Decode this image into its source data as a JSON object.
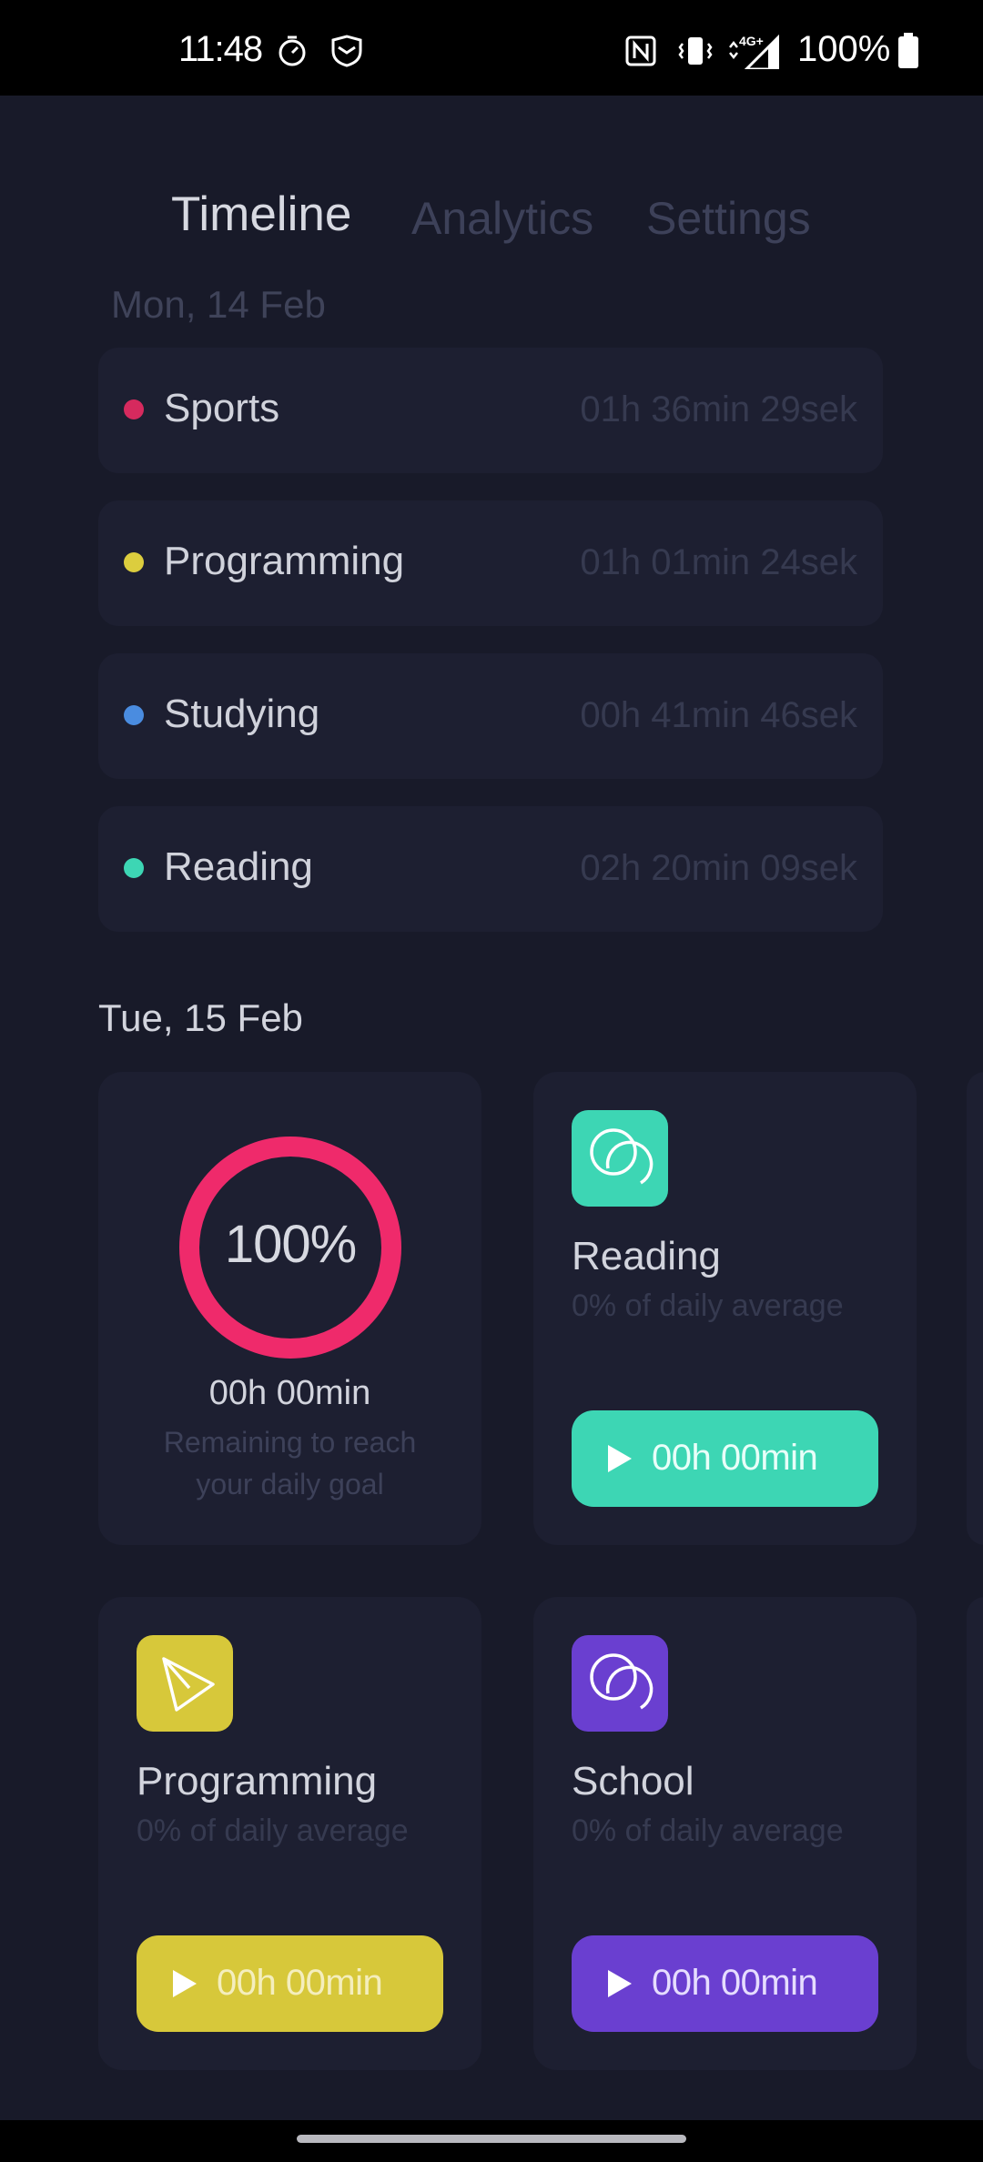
{
  "status_bar": {
    "time": "11:48",
    "battery": "100%",
    "icons": [
      "stopwatch-icon",
      "app-shield-icon",
      "nfc-icon",
      "vibrate-icon",
      "signal-4g-icon",
      "battery-icon"
    ]
  },
  "tabs": [
    {
      "label": "Timeline",
      "active": true
    },
    {
      "label": "Analytics",
      "active": false
    },
    {
      "label": "Settings",
      "active": false
    }
  ],
  "timeline": {
    "day1": {
      "label": "Mon, 14 Feb",
      "entries": [
        {
          "name": "Sports",
          "duration": "01h 36min 29sek",
          "color": "#d62a5e"
        },
        {
          "name": "Programming",
          "duration": "01h 01min 24sek",
          "color": "#dccd3e"
        },
        {
          "name": "Studying",
          "duration": "00h 41min 46sek",
          "color": "#4a8ce0"
        },
        {
          "name": "Reading",
          "duration": "02h 20min 09sek",
          "color": "#3dd6b4"
        }
      ]
    },
    "day2": {
      "label": "Tue, 15 Feb"
    }
  },
  "goal": {
    "percent": "100%",
    "progress": 1.0,
    "remaining": "00h 00min",
    "caption": "Remaining to reach your daily goal",
    "ring_color": "#ef2a6b"
  },
  "activities": [
    {
      "name": "Reading",
      "subtitle": "0% of daily average",
      "timer": "00h 00min",
      "color": "#3dd6b4",
      "icon": "reading-loop-icon"
    },
    {
      "name": "Programming",
      "subtitle": "0% of daily average",
      "timer": "00h 00min",
      "color": "#d7c83a",
      "icon": "programming-paper-plane-icon"
    },
    {
      "name": "School",
      "subtitle": "0% of daily average",
      "timer": "00h 00min",
      "color": "#6a3fd0",
      "icon": "school-loop-icon"
    }
  ]
}
